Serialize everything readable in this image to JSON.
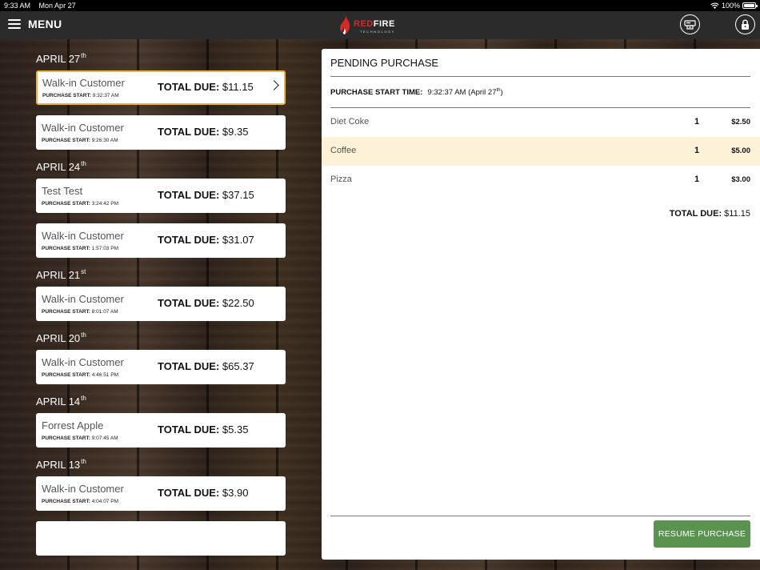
{
  "status_bar": {
    "time": "9:33 AM",
    "date": "Mon Apr 27",
    "battery": "100%"
  },
  "header": {
    "menu_label": "MENU",
    "logo_red": "RED",
    "logo_white": "FIRE",
    "logo_sub": "TECHNOLOGY"
  },
  "groups": [
    {
      "month_day": "APRIL 27",
      "suffix": "th",
      "purchases": [
        {
          "customer": "Walk-in Customer",
          "start_label": "PURCHASE START:",
          "start_time": "9:32:37 AM",
          "total_label": "TOTAL DUE:",
          "total": "$11.15",
          "selected": true
        },
        {
          "customer": "Walk-in Customer",
          "start_label": "PURCHASE START:",
          "start_time": "9:26:30 AM",
          "total_label": "TOTAL DUE:",
          "total": "$9.35"
        }
      ]
    },
    {
      "month_day": "APRIL 24",
      "suffix": "th",
      "purchases": [
        {
          "customer": "Test Test",
          "start_label": "PURCHASE START:",
          "start_time": "3:24:42 PM",
          "total_label": "TOTAL DUE:",
          "total": "$37.15"
        },
        {
          "customer": "Walk-in Customer",
          "start_label": "PURCHASE START:",
          "start_time": "1:57:03 PM",
          "total_label": "TOTAL DUE:",
          "total": "$31.07"
        }
      ]
    },
    {
      "month_day": "APRIL 21",
      "suffix": "st",
      "purchases": [
        {
          "customer": "Walk-in Customer",
          "start_label": "PURCHASE START:",
          "start_time": "8:01:07 AM",
          "total_label": "TOTAL DUE:",
          "total": "$22.50"
        }
      ]
    },
    {
      "month_day": "APRIL 20",
      "suffix": "th",
      "purchases": [
        {
          "customer": "Walk-in Customer",
          "start_label": "PURCHASE START:",
          "start_time": "4:46:51 PM",
          "total_label": "TOTAL DUE:",
          "total": "$65.37"
        }
      ]
    },
    {
      "month_day": "APRIL 14",
      "suffix": "th",
      "purchases": [
        {
          "customer": "Forrest Apple",
          "start_label": "PURCHASE START:",
          "start_time": "9:07:45 AM",
          "total_label": "TOTAL DUE:",
          "total": "$5.35"
        }
      ]
    },
    {
      "month_day": "APRIL 13",
      "suffix": "th",
      "purchases": [
        {
          "customer": "Walk-in Customer",
          "start_label": "PURCHASE START:",
          "start_time": "4:04:07 PM",
          "total_label": "TOTAL DUE:",
          "total": "$3.90"
        }
      ]
    }
  ],
  "detail": {
    "title": "PENDING PURCHASE",
    "start_label": "PURCHASE START TIME:",
    "start_time": "9:32:37 AM (April 27",
    "start_suffix": "th",
    "start_close": ")",
    "items": [
      {
        "name": "Diet Coke",
        "qty": "1",
        "price": "$2.50"
      },
      {
        "name": "Coffee",
        "qty": "1",
        "price": "$5.00",
        "highlight": true
      },
      {
        "name": "Pizza",
        "qty": "1",
        "price": "$3.00"
      }
    ],
    "total_label": "TOTAL DUE:",
    "total": "$11.15",
    "resume_label": "RESUME PURCHASE"
  },
  "colors": {
    "accent_green": "#5a9250",
    "selected_border": "#e8b340",
    "highlight_row": "#fdf1d7",
    "brand_red": "#d32b26"
  },
  "icons": [
    "menu-icon",
    "register-icon",
    "lock-icon",
    "chevron-right-icon",
    "wifi-icon",
    "battery-icon"
  ]
}
